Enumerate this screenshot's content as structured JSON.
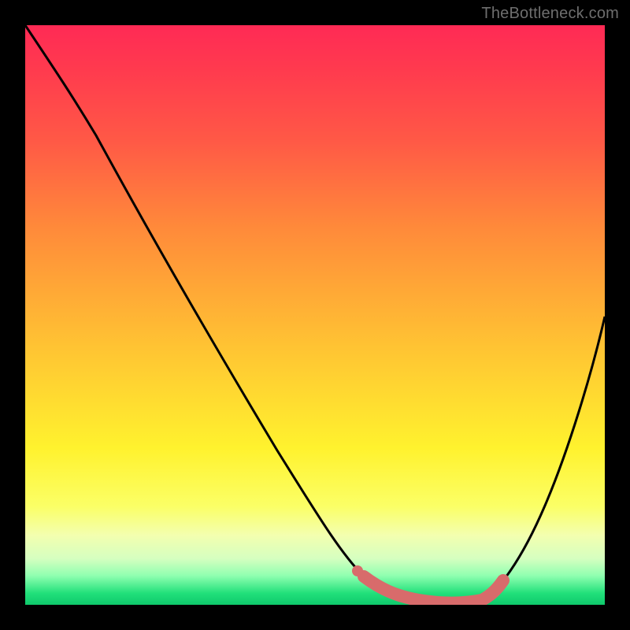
{
  "watermark": "TheBottleneck.com",
  "colors": {
    "frame_bg": "#000000",
    "gradient_top": "#ff2a55",
    "gradient_mid": "#fff22e",
    "gradient_bottom": "#0fc96c",
    "curve_stroke": "#000000",
    "highlight_stroke": "#d86b6b"
  },
  "chart_data": {
    "type": "line",
    "title": "",
    "xlabel": "",
    "ylabel": "",
    "xlim": [
      0,
      100
    ],
    "ylim": [
      0,
      100
    ],
    "series": [
      {
        "name": "bottleneck-curve",
        "x": [
          0,
          5,
          10,
          15,
          20,
          25,
          30,
          35,
          40,
          45,
          50,
          53,
          56,
          60,
          65,
          70,
          74,
          78,
          82,
          86,
          90,
          94,
          98,
          100
        ],
        "values": [
          100,
          94,
          89,
          83,
          77,
          70,
          62,
          53,
          44,
          35,
          26,
          18,
          12,
          7,
          3,
          1,
          0,
          0,
          1,
          5,
          12,
          24,
          40,
          50
        ]
      },
      {
        "name": "highlight-segment",
        "x": [
          56,
          60,
          65,
          70,
          74,
          78,
          82
        ],
        "values": [
          12,
          7,
          3,
          1,
          0,
          0,
          1
        ]
      }
    ],
    "annotations": []
  }
}
